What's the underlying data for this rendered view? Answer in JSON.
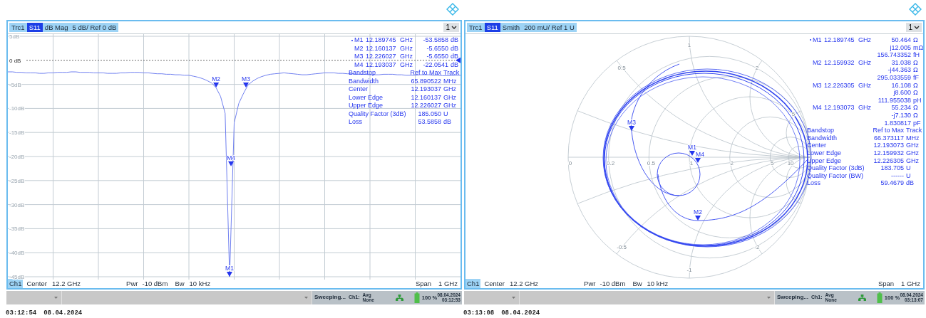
{
  "panels": [
    {
      "kind": "dbmag",
      "trace_chips": [
        {
          "text": "Trc1",
          "selected": false
        },
        {
          "text": "S11",
          "selected": true
        },
        {
          "text": "dB Mag",
          "selected": false
        },
        {
          "text": "5 dB/ Ref 0 dB",
          "selected": false
        }
      ],
      "channel_menu": "1",
      "reference_line": true,
      "chart_data": {
        "type": "line",
        "categories": [
          null,
          null,
          null,
          null,
          null,
          null,
          null,
          null,
          null,
          null,
          null,
          null,
          null,
          null,
          null,
          null,
          null,
          null,
          null,
          null,
          null,
          null,
          null,
          null,
          null,
          null,
          null,
          null,
          null,
          null,
          null,
          null,
          null,
          null,
          null,
          null,
          null,
          null,
          null,
          null,
          null,
          null,
          null,
          null,
          null,
          null,
          null,
          null,
          null,
          null,
          null,
          null,
          null,
          null,
          null,
          null,
          null,
          null,
          null,
          null,
          null,
          null,
          null,
          null,
          null,
          null,
          null,
          null,
          null,
          null,
          null,
          null,
          null,
          null,
          null,
          null,
          null,
          null,
          null,
          null,
          null,
          null,
          null,
          null,
          null,
          null,
          null,
          null,
          null,
          null,
          null,
          null,
          null,
          null,
          null,
          null,
          null,
          null,
          null,
          null,
          null
        ],
        "series": [
          {
            "color": "#7080f0",
            "values": [
              -2.4,
              -2.4,
              -2.5,
              -2.5,
              -2.6,
              -2.6,
              -2.6,
              -2.7,
              -2.7,
              -2.6,
              -2.6,
              -2.5,
              -2.5,
              -2.5,
              -2.4,
              -2.4,
              -2.5,
              -2.5,
              -2.5,
              -2.6,
              -2.6,
              -2.6,
              -2.7,
              -2.7,
              -2.7,
              -2.6,
              -2.6,
              -2.5,
              -2.5,
              -2.5,
              -2.6,
              -2.6,
              -2.7,
              -2.8,
              -2.8,
              -2.9,
              -2.9,
              -3.0,
              -3.0,
              -3.1,
              -3.1,
              -3.3,
              -3.5,
              -3.8,
              -4.2,
              -4.7,
              -5.7,
              -7.5,
              -11,
              -45,
              -13,
              -9,
              -7,
              -5.2,
              -4.4,
              -3.8,
              -3.4,
              -3.1,
              -2.9,
              -2.8,
              -2.7,
              -2.6,
              -2.7,
              -2.8,
              -2.9,
              -3.0,
              -3.0,
              -2.9,
              -2.8,
              -2.7,
              -2.6,
              -2.6,
              -2.6,
              -2.7,
              -2.7,
              -2.8,
              -2.8,
              -2.9,
              -2.9,
              -2.9,
              -3.0,
              -3.0,
              -3.0,
              -2.9,
              -2.9,
              -2.9,
              -3.0,
              -3.0,
              -3.1,
              -3.1,
              -3.1,
              -3.0,
              -3.0,
              -3.0,
              -3.1,
              -3.1,
              -3.2,
              -3.2,
              -3.2,
              -3.1,
              -3.1
            ]
          }
        ],
        "ylim": [
          -45,
          5
        ],
        "grid": true,
        "yticks": [
          {
            "value": 5,
            "label": "5dB"
          },
          {
            "value": 0,
            "label": "0 dB"
          },
          {
            "value": -5,
            "label": "-5dB"
          },
          {
            "value": -10,
            "label": "-10dB"
          },
          {
            "value": -15,
            "label": "-15dB"
          },
          {
            "value": -20,
            "label": "-20dB"
          },
          {
            "value": -25,
            "label": "-25dB"
          },
          {
            "value": -30,
            "label": "-30dB"
          },
          {
            "value": -35,
            "label": "-35dB"
          },
          {
            "value": -40,
            "label": "-40dB"
          },
          {
            "value": -45,
            "label": "-45dB"
          }
        ]
      },
      "chart_markers": [
        {
          "label": "M1"
        },
        {
          "label": "M2"
        },
        {
          "label": "M3"
        },
        {
          "label": "M4"
        }
      ],
      "markers": [
        {
          "label": "M1",
          "active": true,
          "frequency": "12.189745",
          "frequency_unit": "GHz",
          "readings": [
            {
              "value": "-53.5858",
              "unit": "dB"
            }
          ]
        },
        {
          "label": "M2",
          "active": false,
          "frequency": "12.160137",
          "frequency_unit": "GHz",
          "readings": [
            {
              "value": "-5.6550",
              "unit": "dB"
            }
          ]
        },
        {
          "label": "M3",
          "active": false,
          "frequency": "12.226027",
          "frequency_unit": "GHz",
          "readings": [
            {
              "value": "-5.6550",
              "unit": "dB"
            }
          ]
        },
        {
          "label": "M4",
          "active": false,
          "frequency": "12.193037",
          "frequency_unit": "GHz",
          "readings": [
            {
              "value": "-22.0541",
              "unit": "dB"
            }
          ]
        }
      ],
      "bandstop": {
        "header": [
          "Bandstop",
          "Ref to Max",
          "Track"
        ],
        "rows": [
          {
            "label": "Bandwidth",
            "value": "65.890522",
            "unit": "MHz"
          },
          {
            "label": "Center",
            "value": "12.193037",
            "unit": "GHz"
          },
          {
            "label": "Lower Edge",
            "value": "12.160137",
            "unit": "GHz"
          },
          {
            "label": "Upper Edge",
            "value": "12.226027",
            "unit": "GHz"
          },
          {
            "label": "Quality Factor (3dB)",
            "value": "185.050",
            "unit": "U"
          },
          {
            "label": "Loss",
            "value": "53.5858",
            "unit": "dB"
          }
        ]
      },
      "footer": {
        "channel": "Ch1",
        "center_label": "Center",
        "center": "12.2 GHz",
        "power_label": "Pwr",
        "power": "-10 dBm",
        "bw_label": "Bw",
        "bw": "10 kHz",
        "span_label": "Span",
        "span": "1 GHz"
      },
      "status_bar": {
        "sweep": "Sweeping...",
        "channel": "Ch1:",
        "avg_label": "Avg",
        "avg": "None",
        "battery": "100 %",
        "date": "08.04.2024",
        "time": "03:12:53"
      },
      "timestamp": {
        "time": "03:12:54",
        "date": "08.04.2024"
      }
    },
    {
      "kind": "smith",
      "trace_chips": [
        {
          "text": "Trc1",
          "selected": false
        },
        {
          "text": "S11",
          "selected": true
        },
        {
          "text": "Smith",
          "selected": false
        },
        {
          "text": "200 mU/ Ref 1 U",
          "selected": false
        }
      ],
      "channel_menu": "1",
      "resistance_labels": [
        "0",
        "0.2",
        "0.5",
        "1",
        "2",
        "5",
        "10"
      ],
      "reactance_labels": [
        "1",
        "0.5",
        "2",
        "5",
        "-0.5",
        "-1",
        "-2"
      ],
      "chart_markers": [
        {
          "label": "M1"
        },
        {
          "label": "M2"
        },
        {
          "label": "M3"
        },
        {
          "label": "M4"
        }
      ],
      "markers": [
        {
          "label": "M1",
          "active": true,
          "frequency": "12.189745",
          "frequency_unit": "GHz",
          "readings": [
            {
              "value": "50.464",
              "unit": "Ω"
            },
            {
              "value": "j12.005",
              "unit": "mΩ"
            },
            {
              "value": "156.743352",
              "unit": "fH"
            }
          ]
        },
        {
          "label": "M2",
          "active": false,
          "frequency": "12.159932",
          "frequency_unit": "GHz",
          "readings": [
            {
              "value": "31.038",
              "unit": "Ω"
            },
            {
              "value": "-j44.363",
              "unit": "Ω"
            },
            {
              "value": "295.033559",
              "unit": "fF"
            }
          ]
        },
        {
          "label": "M3",
          "active": false,
          "frequency": "12.226305",
          "frequency_unit": "GHz",
          "readings": [
            {
              "value": "16.108",
              "unit": "Ω"
            },
            {
              "value": "j8.600",
              "unit": "Ω"
            },
            {
              "value": "111.955038",
              "unit": "pH"
            }
          ]
        },
        {
          "label": "M4",
          "active": false,
          "frequency": "12.193073",
          "frequency_unit": "GHz",
          "readings": [
            {
              "value": "55.234",
              "unit": "Ω"
            },
            {
              "value": "-j7.130",
              "unit": "Ω"
            },
            {
              "value": "1.830817",
              "unit": "pF"
            }
          ]
        }
      ],
      "bandstop": {
        "header": [
          "Bandstop",
          "Ref to Max",
          "Track"
        ],
        "rows": [
          {
            "label": "Bandwidth",
            "value": "66.373117",
            "unit": "MHz"
          },
          {
            "label": "Center",
            "value": "12.193073",
            "unit": "GHz"
          },
          {
            "label": "Lower Edge",
            "value": "12.159932",
            "unit": "GHz"
          },
          {
            "label": "Upper Edge",
            "value": "12.226305",
            "unit": "GHz"
          },
          {
            "label": "Quality Factor (3dB)",
            "value": "183.705",
            "unit": "U"
          },
          {
            "label": "Quality Factor (BW)",
            "value": "------",
            "unit": "U"
          },
          {
            "label": "Loss",
            "value": "59.4679",
            "unit": "dB"
          }
        ]
      },
      "footer": {
        "channel": "Ch1",
        "center_label": "Center",
        "center": "12.2 GHz",
        "power_label": "Pwr",
        "power": "-10 dBm",
        "bw_label": "Bw",
        "bw": "10 kHz",
        "span_label": "Span",
        "span": "1 GHz"
      },
      "status_bar": {
        "sweep": "Sweeping...",
        "channel": "Ch1:",
        "avg_label": "Avg",
        "avg": "None",
        "battery": "100 %",
        "date": "08.04.2024",
        "time": "03:13:07"
      },
      "timestamp": {
        "time": "03:13:08",
        "date": "08.04.2024"
      }
    }
  ]
}
